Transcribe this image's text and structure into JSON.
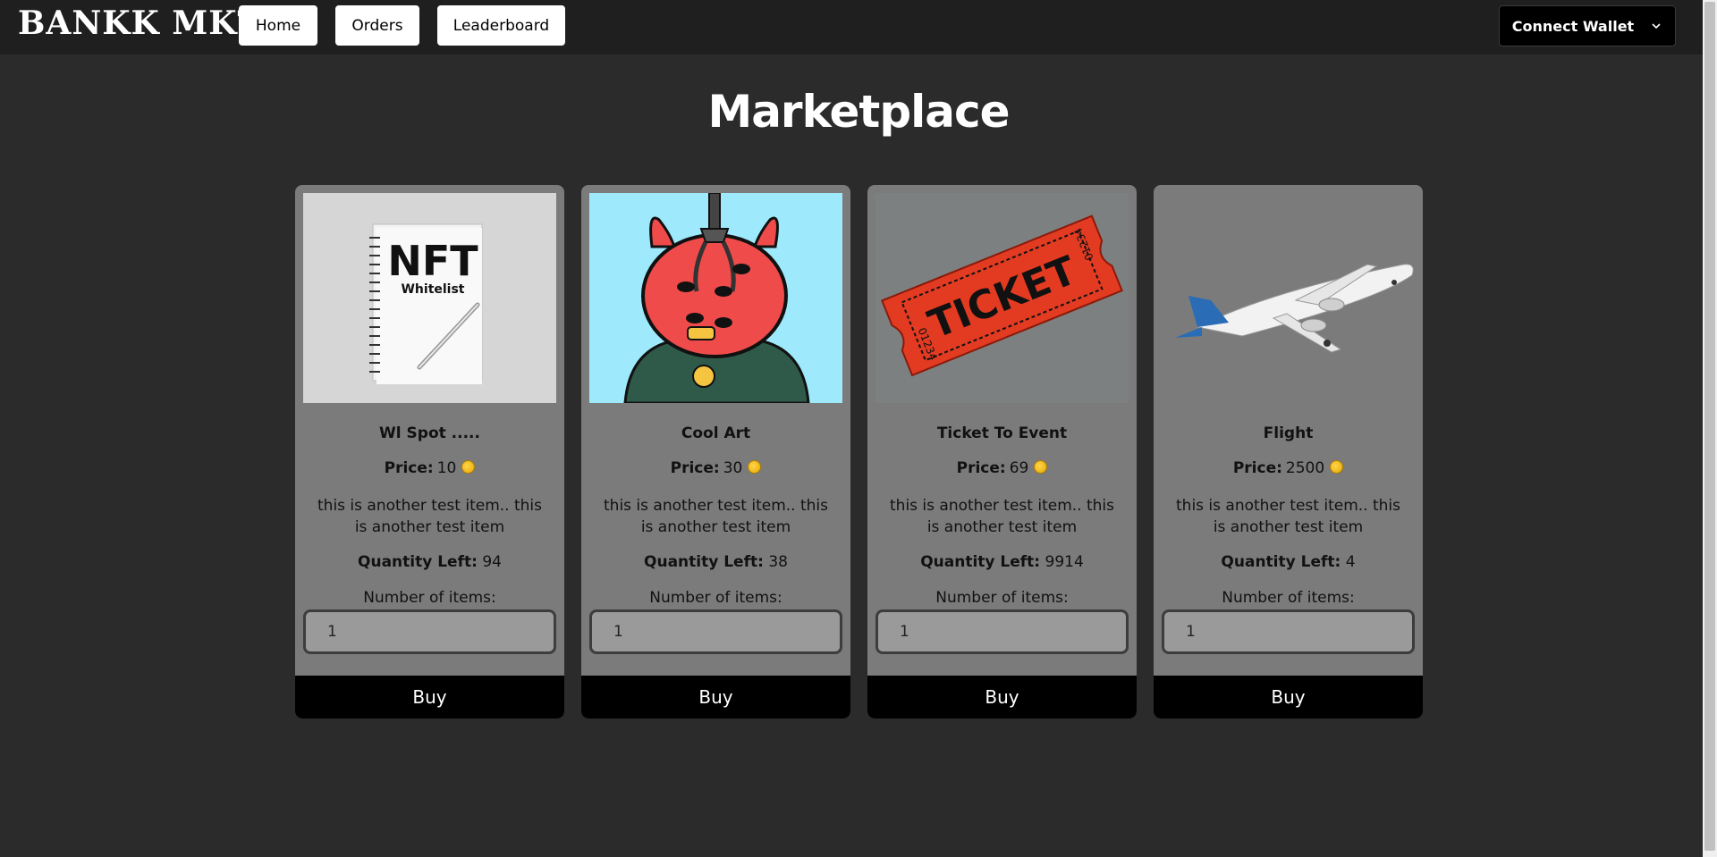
{
  "app": {
    "logo": "BANKK MKT"
  },
  "nav": {
    "home": "Home",
    "orders": "Orders",
    "leaderboard": "Leaderboard",
    "wallet": "Connect Wallet"
  },
  "page": {
    "title": "Marketplace"
  },
  "labels": {
    "price": "Price:",
    "quantity_left": "Quantity Left:",
    "number_of_items": "Number of items:",
    "buy": "Buy"
  },
  "products": [
    {
      "name": "Wl Spot .....",
      "price": "10",
      "description": "this is another test item.. this is another test item",
      "quantity_left": "94",
      "quantity_input": "1",
      "image": "nft-whitelist-notebook"
    },
    {
      "name": "Cool Art",
      "price": "30",
      "description": "this is another test item.. this is another test item",
      "quantity_left": "38",
      "quantity_input": "1",
      "image": "red-monster-art"
    },
    {
      "name": "Ticket To Event",
      "price": "69",
      "description": "this is another test item.. this is another test item",
      "quantity_left": "9914",
      "quantity_input": "1",
      "image": "event-ticket"
    },
    {
      "name": "Flight",
      "price": "2500",
      "description": "this is another test item.. this is another test item",
      "quantity_left": "4",
      "quantity_input": "1",
      "image": "airplane"
    }
  ],
  "image_text": {
    "nft_big": "NFT",
    "nft_small": "Whitelist",
    "ticket": "TICKET",
    "ticket_num_a": "01234",
    "ticket_num_b": "01234"
  },
  "colors": {
    "background": "#2b2b2b",
    "navbar": "#1f1f1f",
    "card": "#7b7b7b",
    "buy_button": "#000000",
    "coin": "#f5b700"
  }
}
